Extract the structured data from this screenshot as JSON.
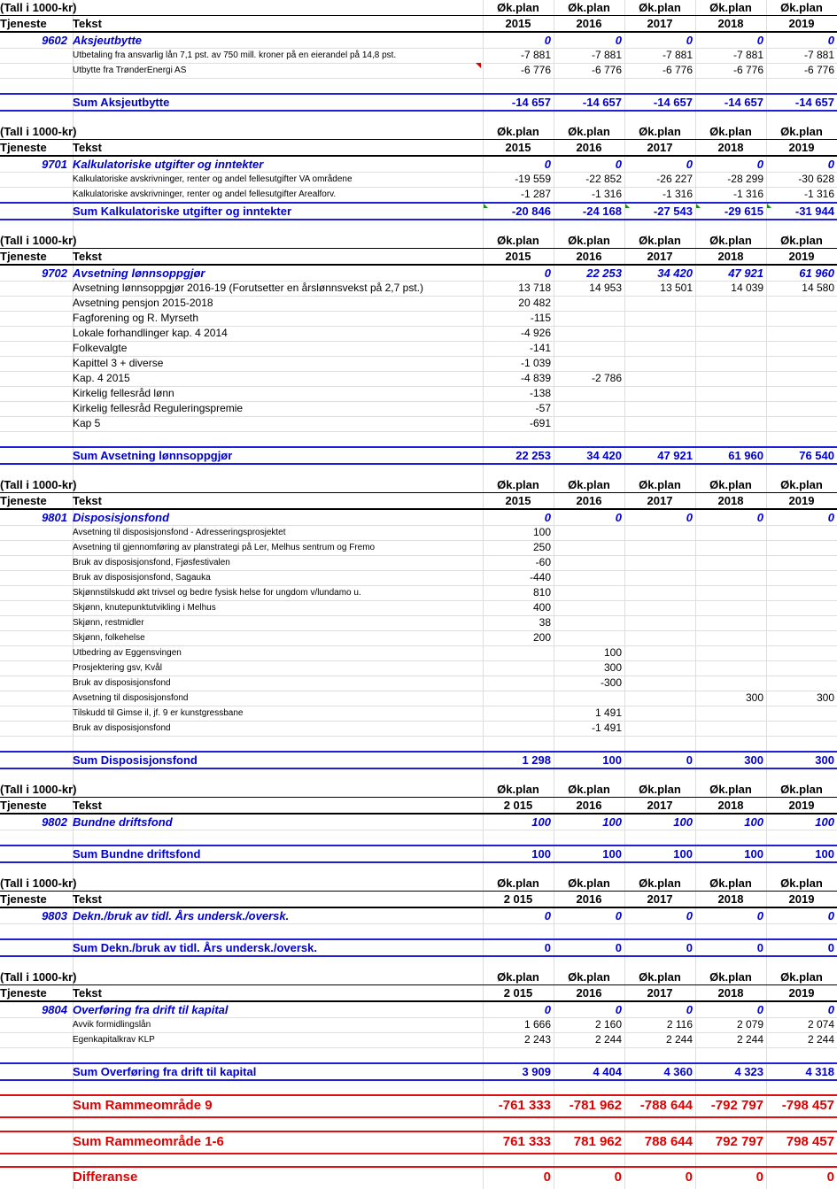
{
  "labels": {
    "unit": "(Tall  i 1000-kr)",
    "plan": "Øk.plan",
    "tjeneste": "Tjeneste",
    "tekst": "Tekst"
  },
  "years_std": [
    "2015",
    "2016",
    "2017",
    "2018",
    "2019"
  ],
  "years_alt": [
    "2 015",
    "2016",
    "2017",
    "2018",
    "2019"
  ],
  "colors": {
    "blue": "#0000cc",
    "red": "#e00000",
    "grid": "#dcdcdc"
  },
  "sections": [
    {
      "code": "9602",
      "title": "Aksjeutbytte",
      "year_style": "std",
      "totals": [
        "0",
        "0",
        "0",
        "0",
        "0"
      ],
      "rows": [
        {
          "text": "Utbetaling fra ansvarlig lån 7,1 pst. av 750 mill. kroner på en eierandel på 14,8 pst.",
          "size": "small",
          "values": [
            "-7 881",
            "-7 881",
            "-7 881",
            "-7 881",
            "-7 881"
          ]
        },
        {
          "text": "Utbytte fra TrønderEnergi AS",
          "size": "small",
          "values": [
            "-6 776",
            "-6 776",
            "-6 776",
            "-6 776",
            "-6 776"
          ]
        }
      ],
      "sum_label": "Sum Aksjeutbytte",
      "sum_values": [
        "-14 657",
        "-14 657",
        "-14 657",
        "-14 657",
        "-14 657"
      ]
    },
    {
      "code": "9701",
      "title": "Kalkulatoriske utgifter og inntekter",
      "year_style": "std",
      "totals": [
        "0",
        "0",
        "0",
        "0",
        "0"
      ],
      "rows": [
        {
          "text": "Kalkulatoriske avskrivninger, renter og andel fellesutgifter VA områdene",
          "size": "small",
          "values": [
            "-19 559",
            "-22 852",
            "-26 227",
            "-28 299",
            "-30 628"
          ]
        },
        {
          "text": "Kalkulatoriske avskrivninger, renter og andel fellesutgifter Arealforv.",
          "size": "small",
          "values": [
            "-1 287",
            "-1 316",
            "-1 316",
            "-1 316",
            "-1 316"
          ]
        }
      ],
      "sum_label": "Sum Kalkulatoriske utgifter og inntekter",
      "sum_values": [
        "-20 846",
        "-24 168",
        "-27 543",
        "-29 615",
        "-31 944"
      ]
    },
    {
      "code": "9702",
      "title": "Avsetning lønnsoppgjør",
      "year_style": "std",
      "totals": [
        "0",
        "22 253",
        "34 420",
        "47 921",
        "61 960"
      ],
      "rows": [
        {
          "text": "Avsetning lønnsoppgjør 2016-19 (Forutsetter en årslønnsvekst på 2,7 pst.)",
          "size": "med",
          "values": [
            "13 718",
            "14 953",
            "13 501",
            "14 039",
            "14 580"
          ]
        },
        {
          "text": "Avsetning pensjon 2015-2018",
          "size": "med",
          "values": [
            "20 482",
            "",
            "",
            "",
            ""
          ]
        },
        {
          "text": "Fagforening og R. Myrseth",
          "size": "med",
          "values": [
            "-115",
            "",
            "",
            "",
            ""
          ]
        },
        {
          "text": "Lokale forhandlinger kap. 4 2014",
          "size": "med",
          "values": [
            "-4 926",
            "",
            "",
            "",
            ""
          ]
        },
        {
          "text": "Folkevalgte",
          "size": "med",
          "values": [
            "-141",
            "",
            "",
            "",
            ""
          ]
        },
        {
          "text": "Kapittel 3 + diverse",
          "size": "med",
          "values": [
            "-1 039",
            "",
            "",
            "",
            ""
          ]
        },
        {
          "text": "Kap. 4 2015",
          "size": "med",
          "values": [
            "-4 839",
            "-2 786",
            "",
            "",
            ""
          ]
        },
        {
          "text": "Kirkelig fellesråd lønn",
          "size": "med",
          "values": [
            "-138",
            "",
            "",
            "",
            ""
          ]
        },
        {
          "text": "Kirkelig fellesråd Reguleringspremie",
          "size": "med",
          "values": [
            "-57",
            "",
            "",
            "",
            ""
          ]
        },
        {
          "text": "Kap 5",
          "size": "med",
          "values": [
            "-691",
            "",
            "",
            "",
            ""
          ]
        }
      ],
      "sum_label": "Sum Avsetning lønnsoppgjør",
      "sum_values": [
        "22 253",
        "34 420",
        "47 921",
        "61 960",
        "76 540"
      ]
    },
    {
      "code": "9801",
      "title": "Disposisjonsfond",
      "year_style": "std",
      "totals": [
        "0",
        "0",
        "0",
        "0",
        "0"
      ],
      "rows": [
        {
          "text": "Avsetning til disposisjonsfond - Adresseringsprosjektet",
          "size": "small",
          "values": [
            "100",
            "",
            "",
            "",
            ""
          ]
        },
        {
          "text": "Avsetning til gjennomføring av planstrategi på Ler, Melhus sentrum og Fremo",
          "size": "small",
          "values": [
            "250",
            "",
            "",
            "",
            ""
          ]
        },
        {
          "text": "Bruk av disposisjonsfond, Fjøsfestivalen",
          "size": "small",
          "values": [
            "-60",
            "",
            "",
            "",
            ""
          ]
        },
        {
          "text": "Bruk av disposisjonsfond, Sagauka",
          "size": "small",
          "values": [
            "-440",
            "",
            "",
            "",
            ""
          ]
        },
        {
          "text": "Skjønnstilskudd økt trivsel og bedre fysisk helse for ungdom v/lundamo u.",
          "size": "small",
          "values": [
            "810",
            "",
            "",
            "",
            ""
          ]
        },
        {
          "text": "Skjønn, knutepunktutvikling i Melhus",
          "size": "small",
          "values": [
            "400",
            "",
            "",
            "",
            ""
          ]
        },
        {
          "text": "Skjønn, restmidler",
          "size": "small",
          "values": [
            "38",
            "",
            "",
            "",
            ""
          ]
        },
        {
          "text": "Skjønn, folkehelse",
          "size": "small",
          "values": [
            "200",
            "",
            "",
            "",
            ""
          ]
        },
        {
          "text": "Utbedring av Eggensvingen",
          "size": "small",
          "values": [
            "",
            "100",
            "",
            "",
            ""
          ]
        },
        {
          "text": "Prosjektering gsv, Kvål",
          "size": "small",
          "values": [
            "",
            "300",
            "",
            "",
            ""
          ]
        },
        {
          "text": "Bruk av disposisjonsfond",
          "size": "small",
          "values": [
            "",
            "-300",
            "",
            "",
            ""
          ]
        },
        {
          "text": "Avsetning til disposisjonsfond",
          "size": "small",
          "values": [
            "",
            "",
            "",
            "300",
            "300"
          ]
        },
        {
          "text": "Tilskudd til Gimse il, jf. 9 er kunstgressbane",
          "size": "small",
          "values": [
            "",
            "1 491",
            "",
            "",
            ""
          ]
        },
        {
          "text": "Bruk av disposisjonsfond",
          "size": "small",
          "values": [
            "",
            "-1 491",
            "",
            "",
            ""
          ]
        }
      ],
      "sum_label": "Sum Disposisjonsfond",
      "sum_values": [
        "1 298",
        "100",
        "0",
        "300",
        "300"
      ]
    },
    {
      "code": "9802",
      "title": "Bundne driftsfond",
      "year_style": "alt",
      "totals": [
        "100",
        "100",
        "100",
        "100",
        "100"
      ],
      "rows": [],
      "sum_label": "Sum Bundne driftsfond",
      "sum_values": [
        "100",
        "100",
        "100",
        "100",
        "100"
      ]
    },
    {
      "code": "9803",
      "title": "Dekn./bruk av tidl. Års undersk./oversk.",
      "year_style": "alt",
      "totals": [
        "0",
        "0",
        "0",
        "0",
        "0"
      ],
      "rows": [],
      "sum_label": "Sum Dekn./bruk av tidl. Års undersk./oversk.",
      "sum_values": [
        "0",
        "0",
        "0",
        "0",
        "0"
      ]
    },
    {
      "code": "9804",
      "title": "Overføring fra drift til kapital",
      "year_style": "alt",
      "totals": [
        "0",
        "0",
        "0",
        "0",
        "0"
      ],
      "rows": [
        {
          "text": "Avvik formidlingslån",
          "size": "small",
          "values": [
            "1 666",
            "2 160",
            "2 116",
            "2 079",
            "2 074"
          ]
        },
        {
          "text": "Egenkapitalkrav KLP",
          "size": "small",
          "values": [
            "2 243",
            "2 244",
            "2 244",
            "2 244",
            "2 244"
          ]
        }
      ],
      "sum_label": "Sum Overføring fra drift til kapital",
      "sum_values": [
        "3 909",
        "4 404",
        "4 360",
        "4 323",
        "4 318"
      ]
    }
  ],
  "grand_totals": [
    {
      "label": "Sum Rammeområde 9",
      "values": [
        "-761 333",
        "-781 962",
        "-788 644",
        "-792 797",
        "-798 457"
      ]
    },
    {
      "label": "Sum Rammeområde 1-6",
      "values": [
        "761 333",
        "781 962",
        "788 644",
        "792 797",
        "798 457"
      ]
    },
    {
      "label": "Differanse",
      "values": [
        "0",
        "0",
        "0",
        "0",
        "0"
      ]
    }
  ]
}
